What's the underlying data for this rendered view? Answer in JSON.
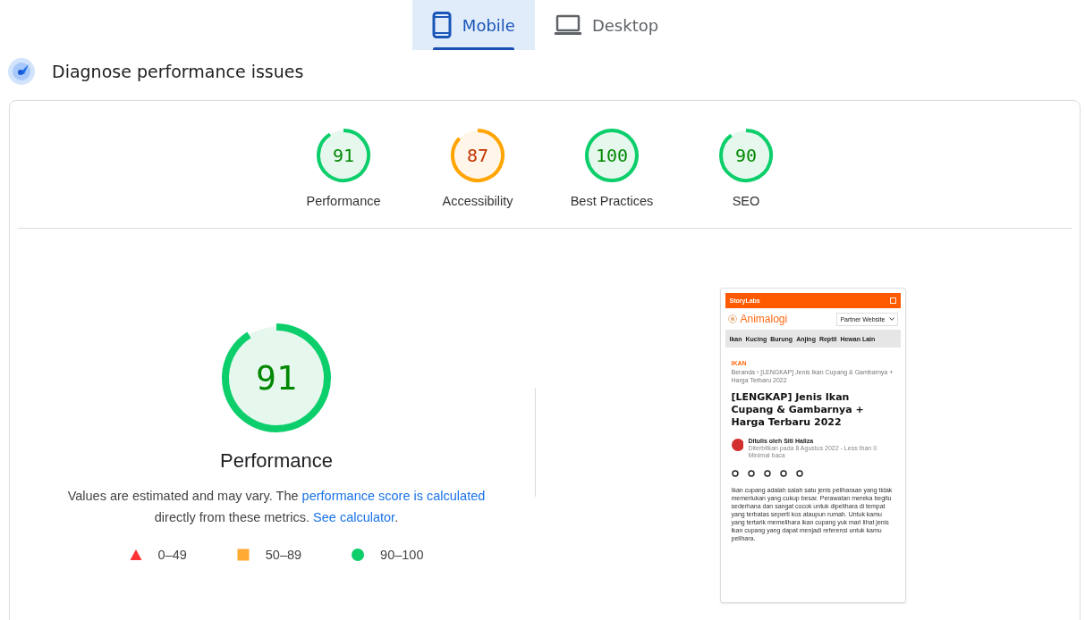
{
  "tabs": [
    {
      "label": "Mobile",
      "selected": true
    },
    {
      "label": "Desktop",
      "selected": false
    }
  ],
  "heading": "Diagnose performance issues",
  "gauges": [
    {
      "score": "91",
      "label": "Performance",
      "level": 0.91
    },
    {
      "score": "87",
      "label": "Accessibility",
      "level": 0.87
    },
    {
      "score": "100",
      "label": "Best Practices",
      "level": 1.0
    },
    {
      "score": "90",
      "label": "SEO",
      "level": 0.9
    }
  ],
  "main_gauge": {
    "score": "91",
    "label": "Performance",
    "level": 0.91
  },
  "note": {
    "before": "Values are estimated and may vary. The ",
    "link1": "performance score is calculated",
    "middle": " directly from these metrics. ",
    "link2": "See calculator",
    "after": "."
  },
  "legend": [
    {
      "kind": "fail",
      "label": "0–49"
    },
    {
      "kind": "average",
      "label": "50–89"
    },
    {
      "kind": "pass",
      "label": "90–100"
    }
  ],
  "screenshot": {
    "topbar": "StoryLabs",
    "logo": "Animalogi",
    "select": "Partner Website",
    "nav": [
      "Ikan",
      "Kucing",
      "Burung",
      "Anjing",
      "Reptil",
      "Hewan Lain"
    ],
    "category": "IKAN",
    "breadcrumb": "Beranda › [LENGKAP] Jenis Ikan Cupang & Gambarnya + Harga Terbaru 2022",
    "title": "[LENGKAP] Jenis Ikan Cupang & Gambarnya + Harga Terbaru 2022",
    "author": "Ditulis oleh Siti Haliza",
    "meta": "Diterbitkan pada 8 Agustus 2022 -  Less than 0 Minimal baca",
    "body": "Ikan cupang adalah salah satu jenis peliharaan yang tidak memerlukan yang cukup besar. Perawatan mereka begitu sederhana dan sangat cocok untuk dipelihara di tempat yang terbatas seperti kos ataupun rumah. Untuk kamu yang tertarik memelihara ikan cupang yuk mari lihat jenis ikan cupang yang dapat menjadi referensi untuk kamu pelihara."
  }
}
